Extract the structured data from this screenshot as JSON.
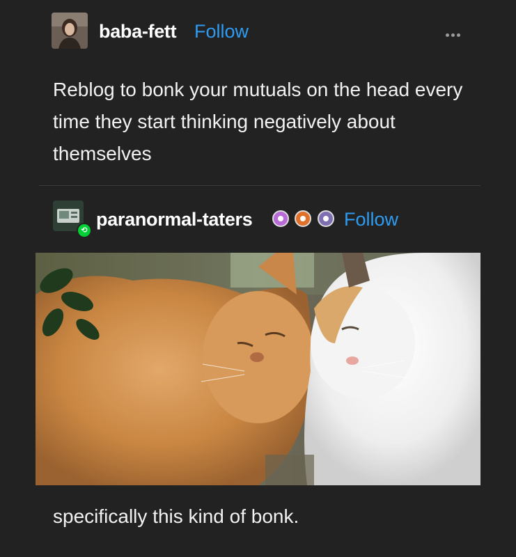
{
  "post": {
    "author": {
      "username": "baba-fett",
      "follow_label": "Follow",
      "avatar_icon": "user-avatar-icon"
    },
    "more_icon": "ellipsis-icon",
    "text": "Reblog to bonk your mutuals on the head every time they start thinking negatively about themselves"
  },
  "reblog": {
    "author": {
      "username": "paranormal-taters",
      "follow_label": "Follow",
      "avatar_icon": "blog-avatar-icon",
      "reblog_badge_icon": "reblog-icon",
      "badges": [
        "purple-badge-icon",
        "orange-paw-badge-icon",
        "purple-paw-badge-icon"
      ]
    },
    "image": "photo of two cats",
    "caption": "specifically this kind of bonk."
  },
  "colors": {
    "background": "#222222",
    "text": "#ffffff",
    "follow": "#2f9bf0",
    "reblog_badge": "#00cf35"
  }
}
